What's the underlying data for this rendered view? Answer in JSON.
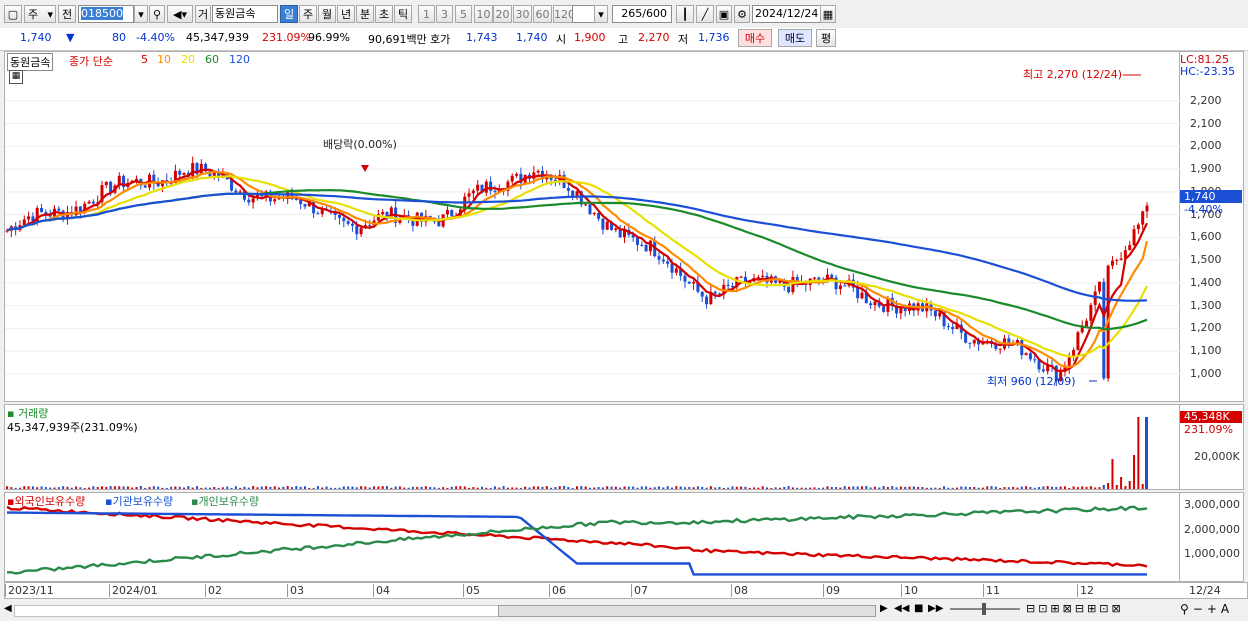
{
  "toolbar": {
    "market": "주",
    "prev_label": "전",
    "code": "018500",
    "group_label": "거",
    "stock_name": "동원금속",
    "periods": [
      "일",
      "주",
      "월",
      "년",
      "분",
      "초",
      "틱"
    ],
    "active_period": "일",
    "intervals": [
      "1",
      "3",
      "5",
      "10",
      "20",
      "30",
      "60",
      "120"
    ],
    "count_current": "265",
    "count_total": "/600",
    "date": "2024/12/24"
  },
  "quote": {
    "price": "1,740",
    "arrow": "▼",
    "change": "80",
    "change_pct": "-4.40%",
    "volume": "45,347,939",
    "volume_ratio": "231.09%",
    "ratio2": "96.99%",
    "amount": "90,691백만",
    "ask_label": "호가",
    "ask": "1,743",
    "bid": "1,740",
    "open_label": "시",
    "open": "1,900",
    "high_label": "고",
    "high": "2,270",
    "low_label": "저",
    "low": "1,736",
    "buy_label": "매수",
    "sell_label": "매도",
    "eval_label": "평"
  },
  "price_pane": {
    "title": "동원금속",
    "ma_label": "종가 단순",
    "ma_periods": [
      "5",
      "10",
      "20",
      "60",
      "120"
    ],
    "ma_colors": [
      "#d40000",
      "#ff8c00",
      "#e8e000",
      "#1a8a2a",
      "#1a4fd6"
    ],
    "lc": "LC:81.25",
    "hc": "HC:-23.35",
    "high_note": "최고 2,270 (12/24)",
    "low_note": "최저 960 (12/09)",
    "dividend_note": "배당락(0.00%)",
    "current_price_tag": "1,740",
    "current_pct_tag": "-4.40%",
    "y_ticks": [
      "2,200",
      "2,100",
      "2,000",
      "1,900",
      "1,800",
      "1,700",
      "1,600",
      "1,500",
      "1,400",
      "1,300",
      "1,200",
      "1,100",
      "1,000"
    ]
  },
  "volume_pane": {
    "title": "거래량",
    "value": "45,347,939주(231.09%)",
    "tag_value": "45,348K",
    "tag_pct": "231.09%",
    "y_ticks": [
      "20,000K"
    ]
  },
  "holdings_pane": {
    "series": [
      "외국인보유수량",
      "기관보유수량",
      "개인보유수량"
    ],
    "colors": [
      "#d40000",
      "#1a4fd6",
      "#2a8a4a"
    ],
    "y_ticks": [
      "3,000,000",
      "2,000,000",
      "1,000,000"
    ]
  },
  "x_axis": {
    "labels": [
      "2023/11",
      "2024/01",
      "02",
      "03",
      "04",
      "05",
      "06",
      "07",
      "08",
      "09",
      "10",
      "11",
      "12"
    ],
    "right_label": "12/24"
  },
  "chart_data": {
    "type": "line",
    "title": "동원금속",
    "x": [
      "2023/11",
      "2024/01",
      "02",
      "03",
      "04",
      "05",
      "06",
      "07",
      "08",
      "09",
      "10",
      "11",
      "12",
      "12/24"
    ],
    "series": [
      {
        "name": "종가",
        "values": [
          1630,
          1780,
          1900,
          1780,
          1660,
          1700,
          1920,
          1630,
          1350,
          1420,
          1330,
          1180,
          1020,
          1740
        ]
      }
    ],
    "ylim": [
      960,
      2270
    ]
  }
}
